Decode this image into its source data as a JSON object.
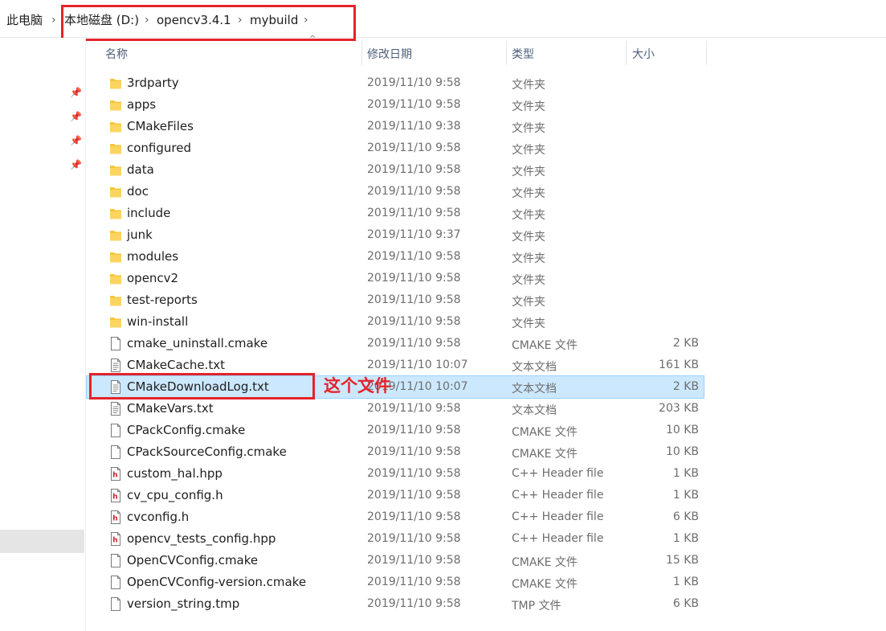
{
  "breadcrumb": {
    "items": [
      "此电脑",
      "本地磁盘 (D:)",
      "opencv3.4.1",
      "mybuild"
    ],
    "separator": "›"
  },
  "columns": {
    "name": "名称",
    "date": "修改日期",
    "type": "类型",
    "size": "大小"
  },
  "annotation": "这个文件",
  "colors": {
    "accent_red": "#e5232a",
    "selection": "#cce8ff",
    "folder": "#f8c53a"
  },
  "files": [
    {
      "name": "3rdparty",
      "date": "2019/11/10 9:58",
      "type": "文件夹",
      "size": "",
      "icon": "folder-icon"
    },
    {
      "name": "apps",
      "date": "2019/11/10 9:58",
      "type": "文件夹",
      "size": "",
      "icon": "folder-icon"
    },
    {
      "name": "CMakeFiles",
      "date": "2019/11/10 9:38",
      "type": "文件夹",
      "size": "",
      "icon": "folder-icon"
    },
    {
      "name": "configured",
      "date": "2019/11/10 9:58",
      "type": "文件夹",
      "size": "",
      "icon": "folder-icon"
    },
    {
      "name": "data",
      "date": "2019/11/10 9:58",
      "type": "文件夹",
      "size": "",
      "icon": "folder-icon"
    },
    {
      "name": "doc",
      "date": "2019/11/10 9:58",
      "type": "文件夹",
      "size": "",
      "icon": "folder-icon"
    },
    {
      "name": "include",
      "date": "2019/11/10 9:58",
      "type": "文件夹",
      "size": "",
      "icon": "folder-icon"
    },
    {
      "name": "junk",
      "date": "2019/11/10 9:37",
      "type": "文件夹",
      "size": "",
      "icon": "folder-icon"
    },
    {
      "name": "modules",
      "date": "2019/11/10 9:58",
      "type": "文件夹",
      "size": "",
      "icon": "folder-icon"
    },
    {
      "name": "opencv2",
      "date": "2019/11/10 9:58",
      "type": "文件夹",
      "size": "",
      "icon": "folder-icon"
    },
    {
      "name": "test-reports",
      "date": "2019/11/10 9:58",
      "type": "文件夹",
      "size": "",
      "icon": "folder-icon"
    },
    {
      "name": "win-install",
      "date": "2019/11/10 9:58",
      "type": "文件夹",
      "size": "",
      "icon": "folder-icon"
    },
    {
      "name": "cmake_uninstall.cmake",
      "date": "2019/11/10 9:58",
      "type": "CMAKE 文件",
      "size": "2 KB",
      "icon": "file-icon"
    },
    {
      "name": "CMakeCache.txt",
      "date": "2019/11/10 10:07",
      "type": "文本文档",
      "size": "161 KB",
      "icon": "text-file-icon"
    },
    {
      "name": "CMakeDownloadLog.txt",
      "date": "2019/11/10 10:07",
      "type": "文本文档",
      "size": "2 KB",
      "icon": "text-file-icon",
      "selected": true
    },
    {
      "name": "CMakeVars.txt",
      "date": "2019/11/10 9:58",
      "type": "文本文档",
      "size": "203 KB",
      "icon": "text-file-icon"
    },
    {
      "name": "CPackConfig.cmake",
      "date": "2019/11/10 9:58",
      "type": "CMAKE 文件",
      "size": "10 KB",
      "icon": "file-icon"
    },
    {
      "name": "CPackSourceConfig.cmake",
      "date": "2019/11/10 9:58",
      "type": "CMAKE 文件",
      "size": "10 KB",
      "icon": "file-icon"
    },
    {
      "name": "custom_hal.hpp",
      "date": "2019/11/10 9:58",
      "type": "C++ Header file",
      "size": "1 KB",
      "icon": "header-file-icon"
    },
    {
      "name": "cv_cpu_config.h",
      "date": "2019/11/10 9:58",
      "type": "C++ Header file",
      "size": "1 KB",
      "icon": "header-file-icon"
    },
    {
      "name": "cvconfig.h",
      "date": "2019/11/10 9:58",
      "type": "C++ Header file",
      "size": "6 KB",
      "icon": "header-file-icon"
    },
    {
      "name": "opencv_tests_config.hpp",
      "date": "2019/11/10 9:58",
      "type": "C++ Header file",
      "size": "1 KB",
      "icon": "header-file-icon"
    },
    {
      "name": "OpenCVConfig.cmake",
      "date": "2019/11/10 9:58",
      "type": "CMAKE 文件",
      "size": "15 KB",
      "icon": "file-icon"
    },
    {
      "name": "OpenCVConfig-version.cmake",
      "date": "2019/11/10 9:58",
      "type": "CMAKE 文件",
      "size": "1 KB",
      "icon": "file-icon"
    },
    {
      "name": "version_string.tmp",
      "date": "2019/11/10 9:58",
      "type": "TMP 文件",
      "size": "6 KB",
      "icon": "file-icon"
    }
  ]
}
